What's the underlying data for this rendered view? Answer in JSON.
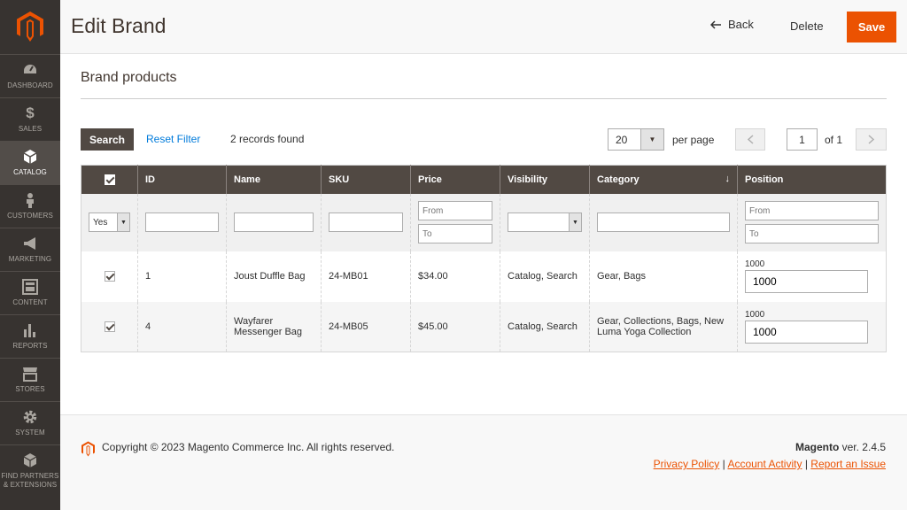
{
  "colors": {
    "accent": "#eb5202",
    "sidebar": "#373330",
    "grid_header": "#514943",
    "link": "#007bdb"
  },
  "sidebar": {
    "logo": "magento-logo-icon",
    "items": [
      {
        "label": "DASHBOARD",
        "icon": "dashboard-icon"
      },
      {
        "label": "SALES",
        "icon": "dollar-icon"
      },
      {
        "label": "CATALOG",
        "icon": "cube-icon",
        "active": true
      },
      {
        "label": "CUSTOMERS",
        "icon": "person-icon"
      },
      {
        "label": "MARKETING",
        "icon": "megaphone-icon"
      },
      {
        "label": "CONTENT",
        "icon": "layout-icon"
      },
      {
        "label": "REPORTS",
        "icon": "bar-chart-icon"
      },
      {
        "label": "STORES",
        "icon": "store-icon"
      },
      {
        "label": "SYSTEM",
        "icon": "gear-icon"
      },
      {
        "label": "FIND PARTNERS & EXTENSIONS",
        "icon": "boxes-icon"
      }
    ]
  },
  "header": {
    "title": "Edit Brand",
    "back_label": "Back",
    "delete_label": "Delete",
    "save_label": "Save"
  },
  "section": {
    "title": "Brand products"
  },
  "toolbar": {
    "search_label": "Search",
    "reset_label": "Reset Filter",
    "records": "2 records found",
    "per_page_value": "20",
    "per_page_label": "per page",
    "page_value": "1",
    "page_of": "of 1"
  },
  "grid": {
    "columns": [
      "ID",
      "Name",
      "SKU",
      "Price",
      "Visibility",
      "Category",
      "Position"
    ],
    "filters": {
      "in_brand": "Yes",
      "price_from_placeholder": "From",
      "price_to_placeholder": "To",
      "position_from_placeholder": "From",
      "position_to_placeholder": "To"
    },
    "rows": [
      {
        "checked": true,
        "id": "1",
        "name": "Joust Duffle Bag",
        "sku": "24-MB01",
        "price": "$34.00",
        "visibility": "Catalog, Search",
        "category": "Gear, Bags",
        "position_label": "1000",
        "position_value": "1000"
      },
      {
        "checked": true,
        "id": "4",
        "name": "Wayfarer Messenger Bag",
        "sku": "24-MB05",
        "price": "$45.00",
        "visibility": "Catalog, Search",
        "category": "Gear, Collections, Bags, New Luma Yoga Collection",
        "position_label": "1000",
        "position_value": "1000"
      }
    ]
  },
  "footer": {
    "copyright": "Copyright © 2023 Magento Commerce Inc. All rights reserved.",
    "brand": "Magento",
    "version": " ver. 2.4.5",
    "links": [
      "Privacy Policy",
      "Account Activity",
      "Report an Issue"
    ]
  }
}
